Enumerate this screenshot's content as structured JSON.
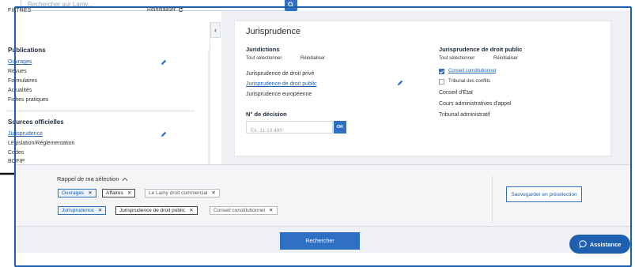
{
  "top_search": {
    "placeholder": "Rechercher sur Lamy..."
  },
  "sidebar": {
    "header": "FILTRES",
    "reset_label": "Réinitialiser",
    "publications": {
      "title": "Publications",
      "items": [
        "Ouvrages",
        "Revues",
        "Formulaires",
        "Actualités",
        "Fiches pratiques"
      ]
    },
    "sources": {
      "title": "Sources officielles",
      "items": [
        "Jurisprudence",
        "Législation/Réglementation",
        "Codes",
        "BOFIP"
      ]
    }
  },
  "main": {
    "title": "Jurisprudence",
    "juridictions": {
      "title": "Juridictions",
      "select_all": "Tout sélectionner",
      "reset": "Réinitialiser",
      "items": [
        "Jurisprudence de droit privé",
        "Jurisprudence de droit public",
        "Jurisprudence européenne"
      ]
    },
    "decision": {
      "title": "N° de décision",
      "placeholder": "Ex. 11-13.490",
      "ok_label": "OK"
    },
    "droit_public": {
      "title": "Jurisprudence de droit public",
      "select_all": "Tout sélectionner",
      "reset": "Réinitialiser",
      "checkbox_items": [
        {
          "label": "Conseil constitutionnel",
          "checked": true
        },
        {
          "label": "Tribunal des conflits",
          "checked": false
        }
      ],
      "items": [
        "Conseil d'État",
        "Cours administratives d'appel",
        "Tribunal administratif"
      ]
    }
  },
  "selection": {
    "title": "Rappel de ma sélection",
    "row1": [
      "Ouvrages",
      "Affaires",
      "Le Lamy droit commercial"
    ],
    "row2": [
      "Jurisprudence",
      "Jurisprudence de droit public",
      "Conseil constitutionnel"
    ],
    "save_label": "Sauvegarder en présélection"
  },
  "actions": {
    "search_label": "Rechercher",
    "assistance_label": "Assistance"
  },
  "colors": {
    "accent": "#2f6fc4",
    "accent_dark": "#1f5fb0"
  }
}
